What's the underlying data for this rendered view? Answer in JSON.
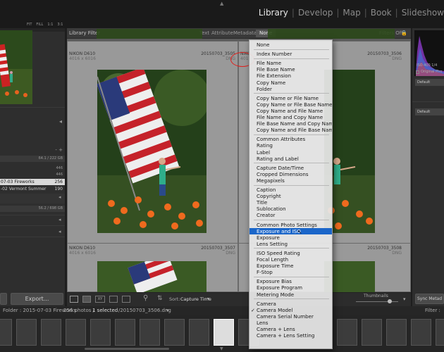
{
  "top_nav": {
    "modules": [
      "Library",
      "Develop",
      "Map",
      "Book",
      "Slideshow"
    ],
    "active": "Library"
  },
  "library_filter": {
    "title": "Library Filter",
    "tabs": [
      "Text",
      "Attribute",
      "Metadata",
      "None"
    ],
    "filters_off": "Filters Off"
  },
  "left_panel": {
    "nav_labels": [
      "FIT",
      "FILL",
      "1:1",
      "3:1"
    ],
    "folder_rows": [
      {
        "name": "",
        "count": "64.1 / 222 GB"
      },
      {
        "name": "",
        "count": "446"
      },
      {
        "name": "",
        "count": "446"
      },
      {
        "name": "07-03 Fireworks",
        "count": "256"
      },
      {
        "name": "-02 Vermont Summer",
        "count": "190"
      },
      {
        "name": "",
        "count": "56.2 / 698 GB"
      }
    ]
  },
  "cells": [
    {
      "camera": "NIKON D610",
      "dims": "4016 x 6016",
      "file": "20150703_3505",
      "ext": "DNG"
    },
    {
      "camera": "NIKO",
      "dims": "4016",
      "file": "20150703_3506",
      "ext": "DNG"
    },
    {
      "camera": "NIKON D610",
      "dims": "4016 x 6016",
      "file": "20150703_3507",
      "ext": "DNG"
    },
    {
      "camera": "",
      "dims": "",
      "file": "20150703_3508",
      "ext": "DNG"
    }
  ],
  "menu": {
    "groups": [
      [
        "None"
      ],
      [
        "Index Number"
      ],
      [
        "File Name",
        "File Base Name",
        "File Extension",
        "Copy Name",
        "Folder"
      ],
      [
        "Copy Name or File Name",
        "Copy Name or File Base Name",
        "Copy Name and File Name",
        "File Name and Copy Name",
        "File Base Name and Copy Name",
        "Copy Name and File Base Name"
      ],
      [
        "Common Attributes",
        "Rating",
        "Label",
        "Rating and Label"
      ],
      [
        "Capture Date/Time",
        "Cropped Dimensions",
        "Megapixels"
      ],
      [
        "Caption",
        "Copyright",
        "Title",
        "Sublocation",
        "Creator"
      ],
      [
        "Common Photo Settings",
        "Exposure and ISO",
        "Exposure",
        "Lens Setting"
      ],
      [
        "ISO Speed Rating",
        "Focal Length",
        "Exposure Time",
        "F-Stop"
      ],
      [
        "Exposure Bias",
        "Exposure Program",
        "Metering Mode"
      ],
      [
        "Camera",
        "Camera Model",
        "Camera Serial Number",
        "Lens",
        "Camera + Lens",
        "Camera + Lens Setting"
      ]
    ],
    "highlighted": "Exposure and ISO",
    "checked": "Camera Model"
  },
  "toolbar": {
    "sort_label": "Sort:",
    "sort_value": "Capture Time",
    "thumbnails": "Thumbnails"
  },
  "left_buttons": {
    "import": "",
    "export": "Export..."
  },
  "right_panel": {
    "original_photo": "Original Pho",
    "default1": "Default",
    "default2": "Default",
    "sync": "Sync Metad",
    "histogram_info": "ISO 400   1/4"
  },
  "filmstrip_bar": {
    "folder": "Folder : 2015-07-03 Fireworks",
    "count": "256 photos /",
    "selected": "1 selected",
    "file": "/20150703_3506.dng",
    "filter": "Filter :"
  },
  "colors": {
    "accent": "#1b66c9",
    "circle": "#e0201c"
  }
}
